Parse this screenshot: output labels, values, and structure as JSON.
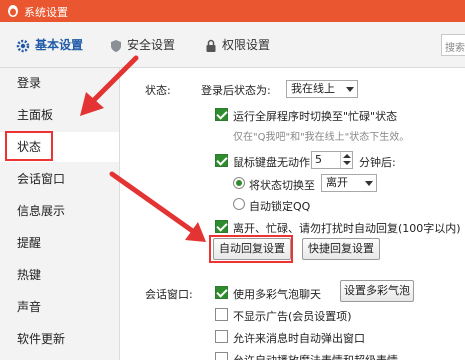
{
  "window": {
    "title": "系统设置"
  },
  "tabs": [
    {
      "label": "基本设置",
      "icon": "gear-icon",
      "active": true
    },
    {
      "label": "安全设置",
      "icon": "shield-icon",
      "active": false
    },
    {
      "label": "权限设置",
      "icon": "lock-icon",
      "active": false
    }
  ],
  "search": {
    "placeholder": "搜索"
  },
  "sidebar": {
    "items": [
      {
        "label": "登录"
      },
      {
        "label": "主面板"
      },
      {
        "label": "状态"
      },
      {
        "label": "会话窗口"
      },
      {
        "label": "信息展示"
      },
      {
        "label": "提醒"
      },
      {
        "label": "热键"
      },
      {
        "label": "声音"
      },
      {
        "label": "软件更新"
      }
    ]
  },
  "status_section": {
    "label": "状态:",
    "after_login_label": "登录后状态为:",
    "after_login_value": "我在线上",
    "fullscreen_busy": {
      "checked": true,
      "label": "运行全屏程序时切换至\"忙碌\"状态"
    },
    "fullscreen_hint": "仅在\"Q我吧\"和\"我在线上\"状态下生效。",
    "idle": {
      "checked": true,
      "label": "鼠标键盘无动作",
      "minutes": "5",
      "suffix": "分钟后:"
    },
    "idle_switch": {
      "checked": true,
      "label": "将状态切换至",
      "value": "离开"
    },
    "idle_lock": {
      "checked": false,
      "label": "自动锁定QQ"
    },
    "auto_reply": {
      "checked": true,
      "label": "离开、忙碌、请勿打扰时自动回复(100字以内)"
    },
    "auto_reply_btn": "自动回复设置",
    "quick_reply_btn": "快捷回复设置"
  },
  "chat_section": {
    "label": "会话窗口:",
    "bubble": {
      "checked": true,
      "label": "使用多彩气泡聊天"
    },
    "bubble_btn": "设置多彩气泡",
    "no_ads": {
      "checked": false,
      "label": "不显示广告(会员设置项)"
    },
    "auto_popup": {
      "checked": false,
      "label": "允许来消息时自动弹出窗口"
    },
    "magic": {
      "checked": false,
      "label": "允许自动播放魔法表情和超级表情"
    }
  },
  "colors": {
    "accent": "#e9562f",
    "annotation": "#e33333",
    "check": "#2e8b2e"
  }
}
